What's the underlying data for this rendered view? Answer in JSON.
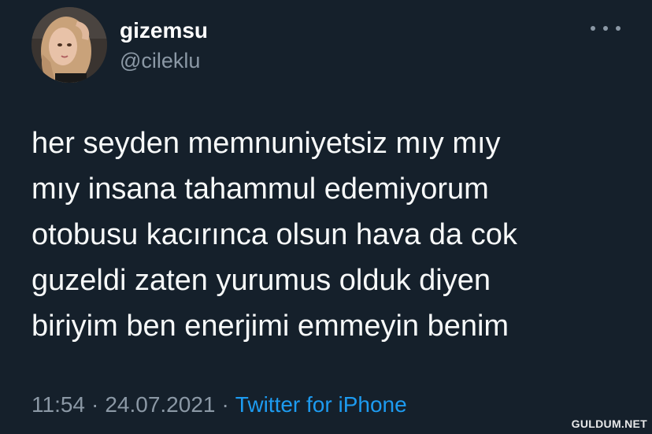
{
  "tweet": {
    "display_name": "gizemsu",
    "handle": "@cileklu",
    "more_icon": "more-horizontal-icon",
    "body_lines": [
      "her seyden memnuniyetsiz mıy mıy",
      "mıy insana tahammul edemiyorum",
      "otobusu kacırınca olsun hava da cok",
      "guzeldi zaten yurumus olduk diyen",
      "biriyim ben enerjimi emmeyin benim"
    ],
    "time": "11:54",
    "date": "24.07.2021",
    "separator": "·",
    "source": "Twitter for iPhone"
  },
  "watermark": "GULDUM.NET",
  "colors": {
    "background": "#15202b",
    "text_primary": "#f7f9f9",
    "text_secondary": "#8b98a5",
    "link": "#1d9bf0"
  }
}
